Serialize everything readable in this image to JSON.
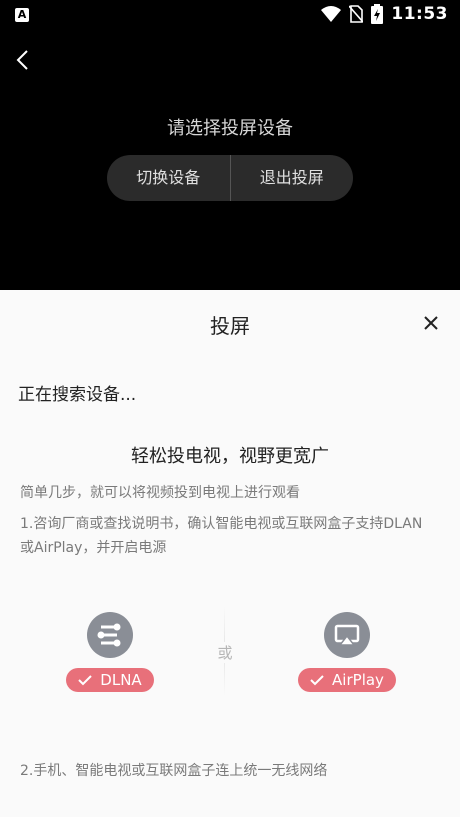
{
  "status_bar": {
    "time": "11:53",
    "left_icon": "A",
    "icons": [
      "wifi-icon",
      "no-sim-icon",
      "battery-charging-icon"
    ]
  },
  "top": {
    "prompt": "请选择投屏设备",
    "switch_device": "切换设备",
    "exit_cast": "退出投屏"
  },
  "sheet": {
    "title": "投屏",
    "searching": "正在搜索设备...",
    "headline": "轻松投电视，视野更宽广",
    "subtext": "简单几步，就可以将视频投到电视上进行观看",
    "step1": "1.咨询厂商或查找说明书，确认智能电视或互联网盒子支持DLAN或AirPlay，并开启电源",
    "or": "或",
    "dlna": "DLNA",
    "airplay": "AirPlay",
    "step2": "2.手机、智能电视或互联网盒子连上统一无线网络"
  },
  "colors": {
    "badge": "#e8707a",
    "icon_bg": "#8a8e96",
    "sheet_bg": "#fafafa",
    "top_bg": "#000000"
  }
}
